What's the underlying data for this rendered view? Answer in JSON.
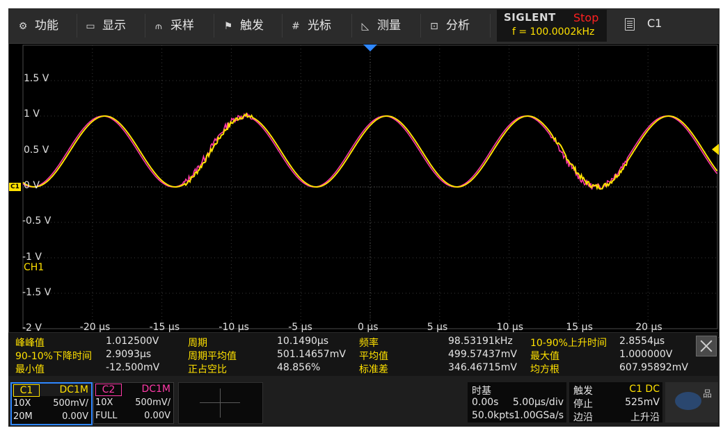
{
  "menu": {
    "items": [
      {
        "label": "功能",
        "icon": "gear-icon",
        "glyph": "⚙"
      },
      {
        "label": "显示",
        "icon": "monitor-icon",
        "glyph": "🖵"
      },
      {
        "label": "采样",
        "icon": "sample-icon",
        "glyph": "⫙"
      },
      {
        "label": "触发",
        "icon": "flag-icon",
        "glyph": "⚑"
      },
      {
        "label": "光标",
        "icon": "cursor-grid-icon",
        "glyph": "#"
      },
      {
        "label": "测量",
        "icon": "measure-icon",
        "glyph": "◺"
      },
      {
        "label": "分析",
        "icon": "analyze-icon",
        "glyph": "⊡"
      }
    ],
    "brand": "SIGLENT",
    "run_state": "Stop",
    "frequency": "f = 100.0002kHz",
    "channel": "C1"
  },
  "waveform": {
    "y_labels": [
      "1.5 V",
      "1 V",
      "0.5 V",
      "0 V",
      "-0.5 V",
      "-1 V",
      "-1.5 V",
      "-2 V"
    ],
    "x_labels": [
      "-20 µs",
      "-15 µs",
      "-10 µs",
      "-5 µs",
      "0 µs",
      "5 µs",
      "10 µs",
      "15 µs",
      "20 µs"
    ],
    "channel_label": "CH1",
    "channel_marker": "C1",
    "colors": {
      "ch1": "#ffe100",
      "ch2": "#ff3aa8",
      "grid": "#3a3a3a",
      "background": "#000000"
    }
  },
  "measurements": {
    "row1": [
      {
        "name": "峰峰值",
        "value": "1.012500V"
      },
      {
        "name": "周期",
        "value": "10.1490µs"
      },
      {
        "name": "频率",
        "value": "98.53191kHz"
      },
      {
        "name": "10-90%上升时间",
        "value": "2.8554µs"
      }
    ],
    "row2": [
      {
        "name": "90-10%下降时间",
        "value": "2.9093µs"
      },
      {
        "name": "周期平均值",
        "value": "501.14657mV"
      },
      {
        "name": "平均值",
        "value": "499.57437mV"
      },
      {
        "name": "最大值",
        "value": "1.000000V"
      }
    ],
    "row3": [
      {
        "name": "最小值",
        "value": "-12.500mV"
      },
      {
        "name": "正占空比",
        "value": "48.856%"
      },
      {
        "name": "标准差",
        "value": "346.46715mV"
      },
      {
        "name": "均方根",
        "value": "607.95892mV"
      }
    ]
  },
  "status": {
    "c1": {
      "name": "C1",
      "coupling": "DC1M",
      "probe": "10X",
      "scale": "500mV/",
      "bw": "20M",
      "offset": "0.00V"
    },
    "c2": {
      "name": "C2",
      "coupling": "DC1M",
      "probe": "10X",
      "scale": "500mV/",
      "bw": "FULL",
      "offset": "0.00V"
    },
    "timebase": {
      "title": "时基",
      "delay": "0.00s",
      "scale": "5.00µs/div",
      "points": "50.0kpts",
      "rate": "1.00GSa/s"
    },
    "trigger": {
      "title": "触发",
      "source": "C1 DC",
      "state": "停止",
      "level": "525mV",
      "type": "边沿",
      "slope": "上升沿"
    }
  }
}
